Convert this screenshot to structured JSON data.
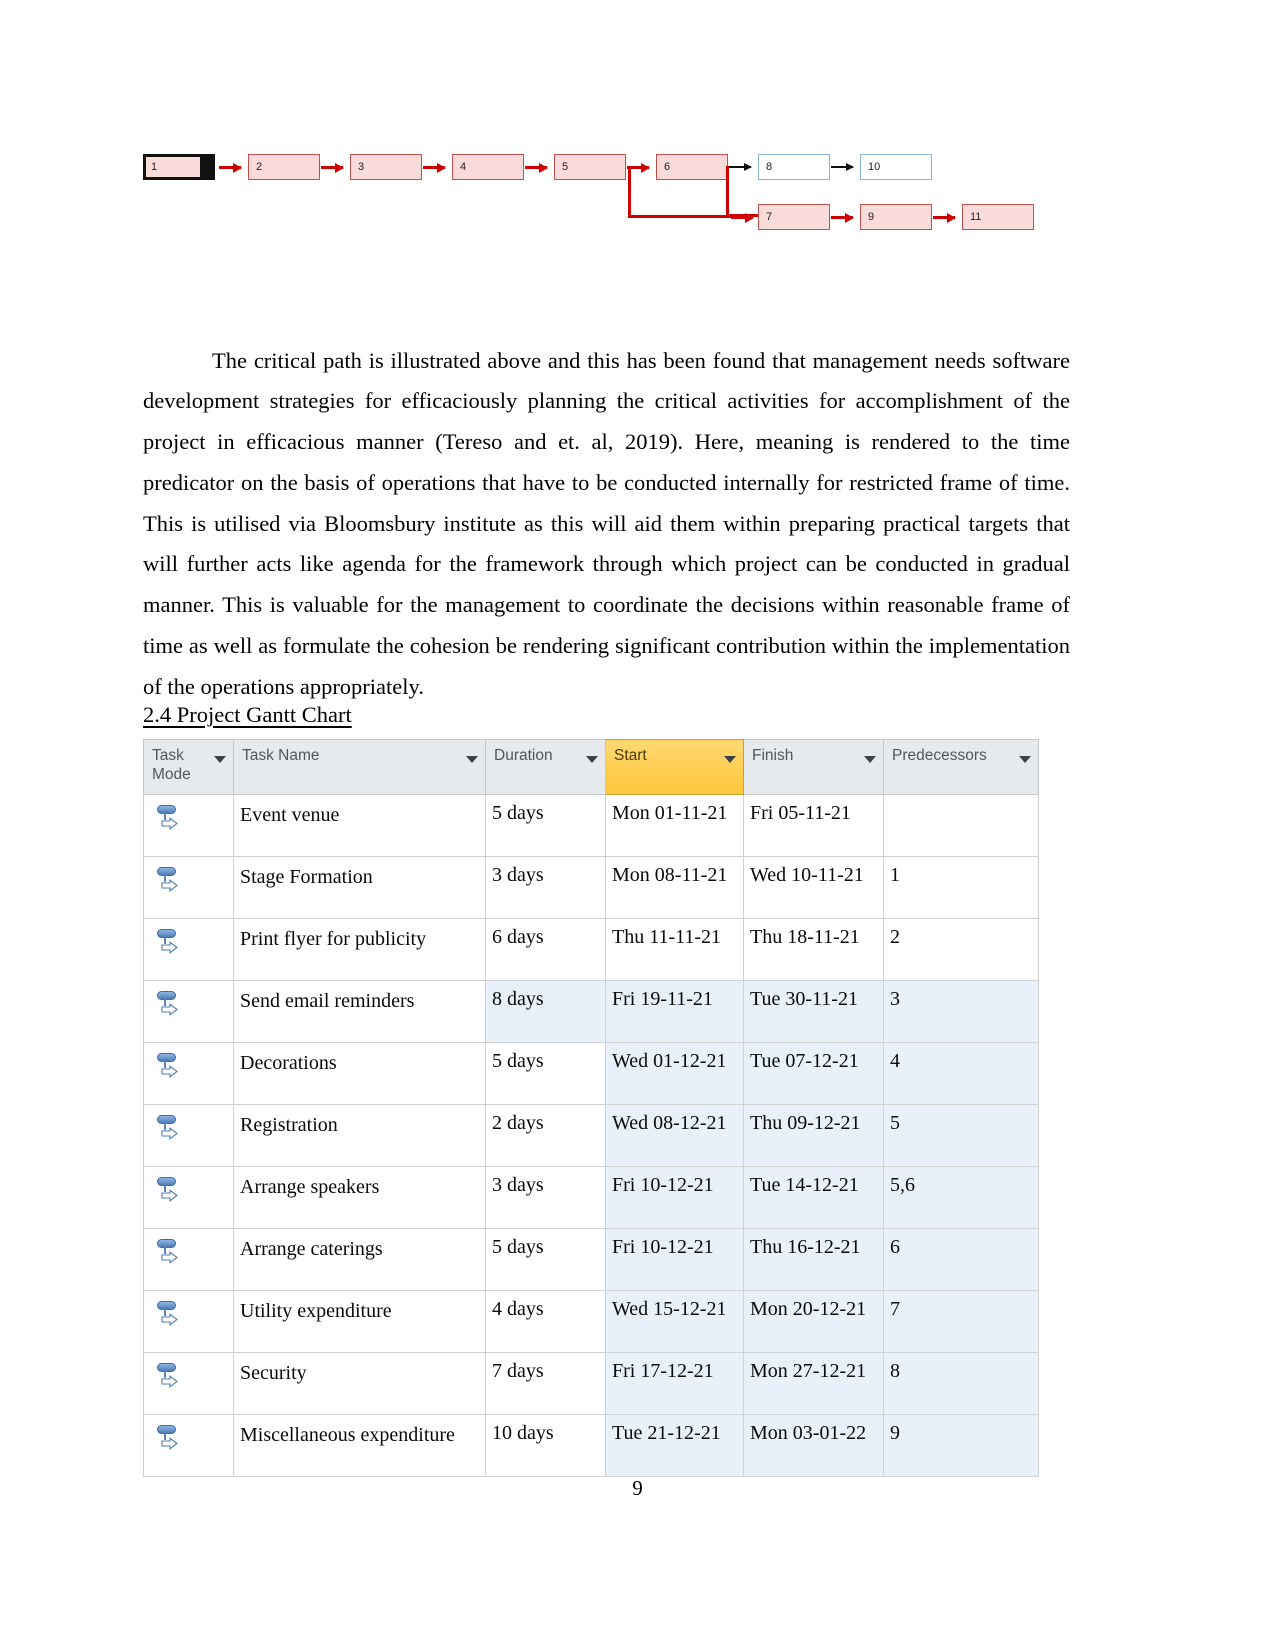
{
  "document": {
    "page_number": "9",
    "section_heading": "2.4 Project Gantt Chart",
    "paragraph": "The critical path is illustrated above and this has been found that management needs software development strategies for efficaciously planning the critical activities for accomplishment of the project in efficacious manner (Tereso and et. al, 2019). Here, meaning is rendered to the time predicator on the basis of operations that have to be conducted internally for restricted frame of time. This is utilised via Bloomsbury institute as this will aid them within preparing practical targets that will further acts like agenda for the framework through which project can be conducted in gradual manner. This is valuable for the management to coordinate the decisions within reasonable frame of time as well as formulate the cohesion be rendering significant contribution within the implementation of the operations appropriately."
  },
  "network_diagram": {
    "critical_color": "#cc0000",
    "critical_fill": "#fadbd9",
    "noncritical_border": "#8db3d9",
    "nodes": [
      {
        "id": "n1",
        "label": "1",
        "critical": true,
        "start": true
      },
      {
        "id": "n2",
        "label": "2",
        "critical": true,
        "start": false
      },
      {
        "id": "n3",
        "label": "3",
        "critical": true,
        "start": false
      },
      {
        "id": "n4",
        "label": "4",
        "critical": true,
        "start": false
      },
      {
        "id": "n5",
        "label": "5",
        "critical": true,
        "start": false
      },
      {
        "id": "n6",
        "label": "6",
        "critical": true,
        "start": false
      },
      {
        "id": "n7",
        "label": "7",
        "critical": true,
        "start": false
      },
      {
        "id": "n8",
        "label": "8",
        "critical": false,
        "start": false
      },
      {
        "id": "n9",
        "label": "9",
        "critical": true,
        "start": false
      },
      {
        "id": "n10",
        "label": "10",
        "critical": false,
        "start": false
      },
      {
        "id": "n11",
        "label": "11",
        "critical": true,
        "start": false
      }
    ]
  },
  "chart_data": {
    "type": "table",
    "title": "2.4 Project Gantt Chart",
    "columns": [
      "Task Mode",
      "Task Name",
      "Duration",
      "Start",
      "Finish",
      "Predecessors"
    ],
    "selected_column": "Start",
    "rows": [
      {
        "mode": "auto",
        "name": "Event venue",
        "duration": "5 days",
        "start": "Mon 01-11-21",
        "finish": "Fri 05-11-21",
        "predecessors": ""
      },
      {
        "mode": "auto",
        "name": "Stage Formation",
        "duration": "3 days",
        "start": "Mon 08-11-21",
        "finish": "Wed 10-11-21",
        "predecessors": "1"
      },
      {
        "mode": "auto",
        "name": "Print flyer for publicity",
        "duration": "6 days",
        "start": "Thu 11-11-21",
        "finish": "Thu 18-11-21",
        "predecessors": "2"
      },
      {
        "mode": "auto",
        "name": "Send email reminders",
        "duration": "8 days",
        "start": "Fri 19-11-21",
        "finish": "Tue 30-11-21",
        "predecessors": "3"
      },
      {
        "mode": "auto",
        "name": "Decorations",
        "duration": "5 days",
        "start": "Wed 01-12-21",
        "finish": "Tue 07-12-21",
        "predecessors": "4"
      },
      {
        "mode": "auto",
        "name": "Registration",
        "duration": "2 days",
        "start": "Wed 08-12-21",
        "finish": "Thu 09-12-21",
        "predecessors": "5"
      },
      {
        "mode": "auto",
        "name": "Arrange speakers",
        "duration": "3 days",
        "start": "Fri 10-12-21",
        "finish": "Tue 14-12-21",
        "predecessors": "5,6"
      },
      {
        "mode": "auto",
        "name": "Arrange caterings",
        "duration": "5 days",
        "start": "Fri 10-12-21",
        "finish": "Thu 16-12-21",
        "predecessors": "6"
      },
      {
        "mode": "auto",
        "name": "Utility expenditure",
        "duration": "4 days",
        "start": "Wed 15-12-21",
        "finish": "Mon 20-12-21",
        "predecessors": "7"
      },
      {
        "mode": "auto",
        "name": "Security",
        "duration": "7 days",
        "start": "Fri 17-12-21",
        "finish": "Mon 27-12-21",
        "predecessors": "8"
      },
      {
        "mode": "auto",
        "name": "Miscellaneous expenditure",
        "duration": "10 days",
        "start": "Tue 21-12-21",
        "finish": "Mon 03-01-22",
        "predecessors": "9"
      }
    ],
    "shading": {
      "accent": "#e8f0fa",
      "cells": [
        {
          "row": 3,
          "cols": [
            "duration",
            "start",
            "finish",
            "predecessors"
          ]
        },
        {
          "row": 4,
          "cols": [
            "start",
            "finish",
            "predecessors"
          ]
        },
        {
          "row": 5,
          "cols": [
            "start",
            "finish",
            "predecessors"
          ]
        },
        {
          "row": 6,
          "cols": [
            "start",
            "finish",
            "predecessors"
          ]
        },
        {
          "row": 7,
          "cols": [
            "start",
            "finish",
            "predecessors"
          ]
        },
        {
          "row": 8,
          "cols": [
            "start",
            "finish",
            "predecessors"
          ]
        },
        {
          "row": 9,
          "cols": [
            "start",
            "finish",
            "predecessors"
          ]
        },
        {
          "row": 10,
          "cols": [
            "start",
            "finish",
            "predecessors"
          ]
        }
      ]
    }
  }
}
